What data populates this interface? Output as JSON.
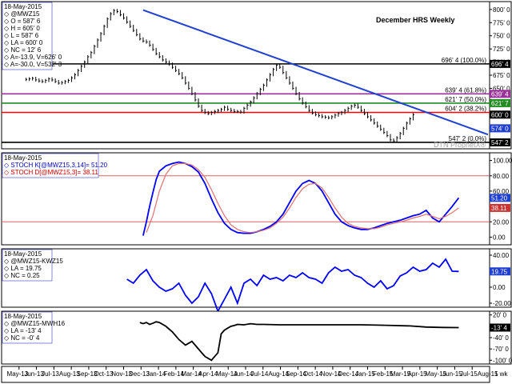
{
  "chart_data": [
    {
      "type": "line",
      "panel": "price",
      "title": "December HRS Weekly",
      "info_lines": [
        "18-May-2015",
        "@MWZ15",
        "O = 587' 6",
        "H = 605' 0",
        "L = 587' 6",
        "LA = 600' 0",
        "NC = 12' 6",
        "A=-13.9, V=626' 0",
        "A=-30.0, V=532' 3"
      ],
      "y_ticks": [
        "800' 0",
        "775' 0",
        "750' 0",
        "725' 0",
        "700' 0",
        "675' 0",
        "650' 0",
        "625' 0",
        "600' 0",
        "575' 0",
        "550' 0"
      ],
      "ylim": [
        535,
        815
      ],
      "weeks": 150,
      "start_week": 7,
      "prices": [
        667,
        668,
        669,
        666,
        664,
        663,
        665,
        668,
        666,
        663,
        660,
        661,
        663,
        665,
        670,
        676,
        684,
        692,
        700,
        710,
        718,
        730,
        742,
        754,
        768,
        782,
        792,
        798,
        796,
        790,
        784,
        776,
        768,
        760,
        752,
        744,
        740,
        738,
        732,
        724,
        716,
        710,
        704,
        700,
        696,
        690,
        684,
        678,
        670,
        660,
        650,
        640,
        628,
        616,
        608,
        604,
        602,
        604,
        606,
        608,
        610,
        614,
        610,
        608,
        606,
        606,
        605,
        612,
        618,
        624,
        632,
        640,
        648,
        656,
        666,
        676,
        686,
        694,
        690,
        680,
        670,
        660,
        650,
        640,
        630,
        622,
        615,
        608,
        603,
        600,
        598,
        596,
        595,
        594,
        596,
        599,
        602,
        604,
        608,
        612,
        616,
        618,
        614,
        608,
        602,
        596,
        590,
        584,
        578,
        572,
        566,
        560,
        552,
        550,
        556,
        564,
        574,
        584,
        592,
        600
      ],
      "trendline": {
        "x": [
          43,
          141
        ],
        "y": [
          799,
          580
        ]
      },
      "levels": [
        {
          "label": "696' 4 (100.0%)",
          "value": 696.5,
          "color": "#000000"
        },
        {
          "label": "639' 4 (61.8%)",
          "value": 639.5,
          "color": "#993399"
        },
        {
          "label": "621' 7 (50.0%)",
          "value": 621.9,
          "color": "#228b22"
        },
        {
          "label": "604' 2 (38.2%)",
          "value": 604.25,
          "color": "#ff0000"
        },
        {
          "label": "547' 2 (0.0%)",
          "value": 547.25,
          "color": "#000000"
        }
      ],
      "right_tags": [
        {
          "text": "696' 4",
          "value": 696.5,
          "color": "#000000"
        },
        {
          "text": "639' 4",
          "value": 639.5,
          "color": "#993399"
        },
        {
          "text": "621' 7",
          "value": 621.9,
          "color": "#228b22"
        },
        {
          "text": "600' 0",
          "value": 600,
          "color": "#000000"
        },
        {
          "text": "574' 0",
          "value": 574,
          "color": "#1f3fcf"
        },
        {
          "text": "547' 2",
          "value": 547.25,
          "color": "#000000"
        }
      ],
      "watermark": "DTN ProphetX®"
    },
    {
      "type": "line",
      "panel": "stochastics",
      "info_lines": [
        "18-May-2015",
        "STOCH K[@MWZ15,3,14]= 51.20",
        "STOCH D[@MWZ15,3]= 38.11"
      ],
      "y_ticks": [
        "100.00",
        "80.00",
        "60.00",
        "40.00",
        "20.00",
        "0.00"
      ],
      "ylim": [
        -10,
        110
      ],
      "overbought": 80,
      "oversold": 20,
      "series": [
        {
          "name": "STOCH K[@MWZ15,3,14]",
          "color": "#0000ff",
          "x": [
            43,
            44,
            45,
            46,
            47,
            48,
            50,
            52,
            54,
            56,
            58,
            60,
            62,
            64,
            66,
            68,
            70,
            72,
            74,
            76,
            78,
            80,
            82,
            84,
            86,
            88,
            90,
            92,
            94,
            96,
            98,
            100,
            102,
            104,
            106,
            108,
            110,
            112,
            114,
            116,
            118,
            120,
            122,
            124,
            126,
            128,
            130,
            132,
            134,
            136,
            138,
            140
          ],
          "values": [
            2,
            20,
            40,
            58,
            75,
            86,
            93,
            96,
            98,
            96,
            92,
            85,
            70,
            50,
            32,
            18,
            10,
            6,
            5,
            5,
            7,
            10,
            14,
            20,
            30,
            45,
            60,
            70,
            74,
            70,
            60,
            45,
            30,
            20,
            15,
            12,
            10,
            10,
            12,
            15,
            18,
            20,
            22,
            25,
            28,
            30,
            35,
            25,
            20,
            30,
            40,
            51.2
          ]
        },
        {
          "name": "STOCH D[@MWZ15,3]",
          "color": "#e07070",
          "x": [
            44,
            46,
            48,
            50,
            52,
            54,
            56,
            58,
            60,
            62,
            64,
            66,
            68,
            70,
            72,
            74,
            76,
            78,
            80,
            82,
            84,
            86,
            88,
            90,
            92,
            94,
            96,
            98,
            100,
            102,
            104,
            106,
            108,
            110,
            112,
            114,
            116,
            118,
            120,
            122,
            124,
            126,
            128,
            130,
            132,
            134,
            136,
            138,
            140
          ],
          "values": [
            6,
            28,
            60,
            82,
            93,
            96,
            96,
            94,
            88,
            78,
            62,
            44,
            28,
            16,
            10,
            7,
            6,
            7,
            9,
            12,
            18,
            26,
            38,
            52,
            63,
            69,
            70,
            64,
            52,
            38,
            26,
            18,
            14,
            12,
            11,
            11,
            13,
            16,
            18,
            20,
            22,
            25,
            27,
            30,
            27,
            24,
            27,
            32,
            38.11
          ]
        }
      ],
      "right_tags": [
        {
          "text": "51.20",
          "value": 51.2,
          "color": "#1f3fcf"
        },
        {
          "text": "38.11",
          "value": 38.11,
          "color": "#cc3333"
        }
      ]
    },
    {
      "type": "line",
      "panel": "spread-mwz15-kwz15",
      "info_lines": [
        "18-May-2015",
        "@MWZ15-KWZ15",
        "LA = 19.75",
        "NC = 0.25"
      ],
      "y_ticks": [
        "40.00",
        "20.00",
        "0.00",
        "-20.00"
      ],
      "ylim": [
        -25,
        48
      ],
      "series": [
        {
          "name": "@MWZ15-KWZ15",
          "color": "#0000ff",
          "x": [
            38,
            40,
            42,
            44,
            46,
            48,
            50,
            52,
            54,
            56,
            58,
            60,
            62,
            64,
            66,
            68,
            70,
            72,
            74,
            76,
            78,
            80,
            82,
            84,
            86,
            88,
            90,
            92,
            94,
            96,
            98,
            100,
            102,
            104,
            106,
            108,
            110,
            112,
            114,
            116,
            118,
            120,
            122,
            124,
            126,
            128,
            130,
            132,
            134,
            136,
            138,
            140
          ],
          "values": [
            10,
            5,
            15,
            22,
            8,
            0,
            -5,
            -2,
            5,
            -10,
            -20,
            -12,
            5,
            -8,
            -30,
            -15,
            0,
            -20,
            5,
            10,
            2,
            15,
            10,
            12,
            8,
            15,
            12,
            18,
            12,
            10,
            5,
            18,
            25,
            20,
            22,
            15,
            12,
            5,
            0,
            8,
            -2,
            2,
            14,
            18,
            25,
            20,
            22,
            30,
            25,
            35,
            20,
            19.75
          ]
        }
      ],
      "right_tags": [
        {
          "text": "19.75",
          "value": 19.75,
          "color": "#1f3fcf"
        }
      ]
    },
    {
      "type": "line",
      "panel": "spread-mwz15-mwh16",
      "info_lines": [
        "18-May-2015",
        "@MWZ15-MWH16",
        "LA = -13' 4",
        "NC = -0' 4"
      ],
      "y_ticks": [
        "20' 0",
        "-13' 4",
        "-40' 0",
        "-70' 0",
        "-100' 0"
      ],
      "ylim": [
        -110,
        30
      ],
      "series": [
        {
          "name": "@MWZ15-MWH16",
          "color": "#000000",
          "x": [
            42,
            43,
            44,
            45,
            46,
            47,
            48,
            50,
            52,
            54,
            56,
            58,
            60,
            62,
            64,
            66,
            67,
            68,
            69,
            70,
            71,
            72,
            74,
            76,
            78,
            80,
            85,
            90,
            95,
            100,
            105,
            110,
            115,
            120,
            125,
            130,
            135,
            140
          ],
          "values": [
            0,
            -3,
            0,
            -5,
            -2,
            2,
            0,
            -10,
            -25,
            -45,
            -60,
            -50,
            -70,
            -90,
            -100,
            -80,
            -30,
            -20,
            -15,
            -10,
            -8,
            -5,
            -6,
            -3,
            -5,
            -5,
            -6,
            -6,
            -6,
            -6,
            -6,
            -6,
            -7,
            -8,
            -9,
            -12,
            -13,
            -13.5
          ]
        }
      ],
      "right_tags": [
        {
          "text": "-13' 4",
          "value": -13.5,
          "color": "#000000"
        }
      ]
    }
  ],
  "x_axis": {
    "labels": [
      "May-13",
      "Jun-13",
      "Jul-13",
      "Aug-13",
      "Sep-13",
      "Oct-13",
      "Nov-13",
      "Dec-13",
      "Jan-14",
      "Feb-14",
      "Mar-14",
      "Apr-14",
      "May-14",
      "Jun-14",
      "Jul-14",
      "Aug-14",
      "Sep-14",
      "Oct-14",
      "Nov-14",
      "Dec-14",
      "Jan-15",
      "Feb-15",
      "Mar-15",
      "Apr-15",
      "May-15",
      "Jun-15",
      "Jul-15",
      "Aug-15"
    ],
    "corner_label": "1 wk"
  }
}
